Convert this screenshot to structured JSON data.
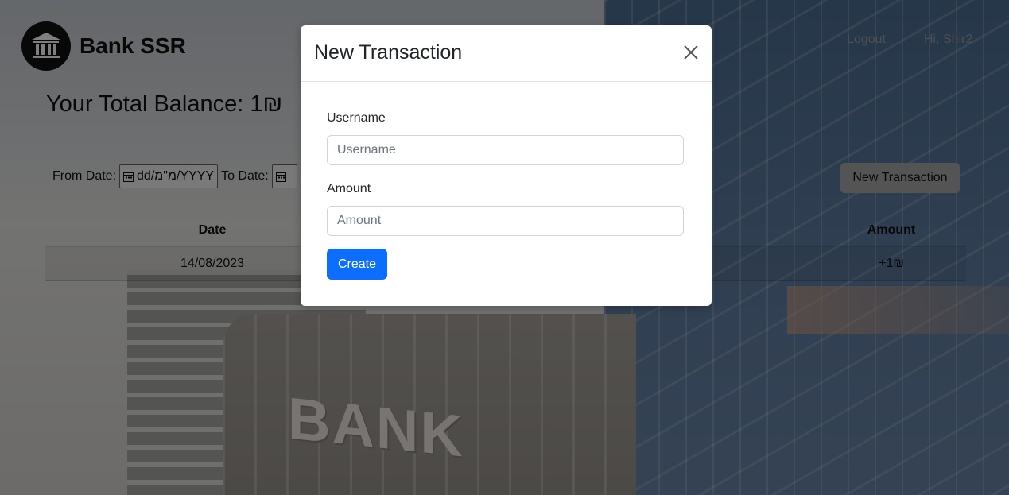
{
  "brand": {
    "name": "Bank SSR",
    "logo_icon": "bank-building-icon"
  },
  "nav": {
    "logout_label": "Logout",
    "greeting": "Hi, Shir2"
  },
  "balance": {
    "text": "Your Total Balance: 1₪"
  },
  "filters": {
    "from_label": "From Date:",
    "from_placeholder": "dd/מ\"מ/YYYY",
    "to_label": "To Date:"
  },
  "actions": {
    "new_transaction_label": "New Transaction"
  },
  "table": {
    "headers": {
      "date": "Date",
      "amount": "Amount"
    },
    "rows": [
      {
        "date": "14/08/2023",
        "amount": "+1₪"
      }
    ]
  },
  "background": {
    "sign_text": "BANK"
  },
  "modal": {
    "title": "New Transaction",
    "username_label": "Username",
    "username_placeholder": "Username",
    "amount_label": "Amount",
    "amount_placeholder": "Amount",
    "create_label": "Create",
    "primary_color": "#0d6efd"
  }
}
